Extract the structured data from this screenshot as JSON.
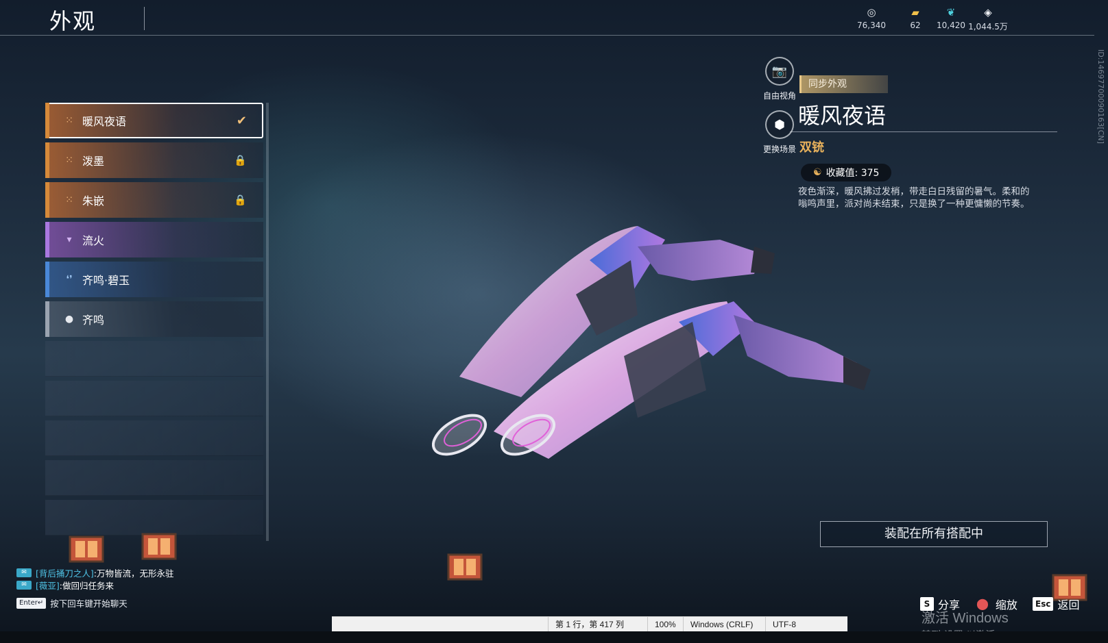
{
  "header": {
    "title": "外观",
    "currencies": [
      {
        "icon": "coin-swirl-icon",
        "glyph": "◎",
        "value": "76,340",
        "color": "#e6e9ee"
      },
      {
        "icon": "ticket-icon",
        "glyph": "▰",
        "value": "62",
        "color": "#f1c04a"
      },
      {
        "icon": "feather-icon",
        "glyph": "❦",
        "value": "10,420",
        "color": "#4fd2e0"
      },
      {
        "icon": "diamond-icon",
        "glyph": "◈",
        "value": "1,044.5万",
        "color": "#f0f2f6"
      }
    ]
  },
  "side_id": "ID:1469770009016​3[CN]",
  "skins": [
    {
      "name": "暖风夜语",
      "quality": "orange",
      "glyph": "⁙",
      "right": "✔",
      "selected": true
    },
    {
      "name": "泼墨",
      "quality": "orange",
      "glyph": "⁙",
      "right": "🔒",
      "selected": false
    },
    {
      "name": "朱嵌",
      "quality": "orange",
      "glyph": "⁙",
      "right": "🔒",
      "selected": false
    },
    {
      "name": "流火",
      "quality": "purple",
      "glyph": "▾",
      "right": "",
      "selected": false
    },
    {
      "name": "齐鸣·碧玉",
      "quality": "blue",
      "glyph": "❛❜",
      "right": "",
      "selected": false
    },
    {
      "name": "齐鸣",
      "quality": "grey",
      "glyph": "●",
      "right": "",
      "selected": false
    }
  ],
  "camera": {
    "free_view": {
      "label": "自由视角",
      "icon": "camera-icon",
      "glyph": "📷"
    },
    "change_scene": {
      "label": "更换场景",
      "icon": "cube-icon",
      "glyph": "⬢"
    }
  },
  "detail": {
    "sync_badge": "同步外观",
    "name": "暖风夜语",
    "weapon_type": "双铳",
    "collect_label": "收藏值: 375",
    "description": "夜色渐深，暖风拂过发梢，带走白日残留的暑气。柔和的嗡鸣声里，派对尚未结束，只是换了一种更慵懒的节奏。",
    "equip_button": "装配在所有搭配中"
  },
  "chat": {
    "lines": [
      {
        "tag": "✉",
        "speaker": "[背后捅刀之人]",
        "text": ":万物皆流，无形永驻"
      },
      {
        "tag": "✉",
        "speaker": "[薇亚]",
        "text": ":做回归任务来"
      }
    ],
    "enter_key": "Enter↵",
    "hint": "按下回车键开始聊天"
  },
  "actions": [
    {
      "key": "S",
      "label": "分享"
    },
    {
      "key": "⬤",
      "label": "缩放"
    },
    {
      "key": "Esc",
      "label": "返回"
    }
  ],
  "statusbar": {
    "position": "第 1 行，第 417 列",
    "zoom": "100%",
    "line_ending": "Windows (CRLF)",
    "encoding": "UTF-8"
  },
  "activate": {
    "line1": "激活 Windows",
    "line2": "转到“设置”以激活 Windows。"
  }
}
